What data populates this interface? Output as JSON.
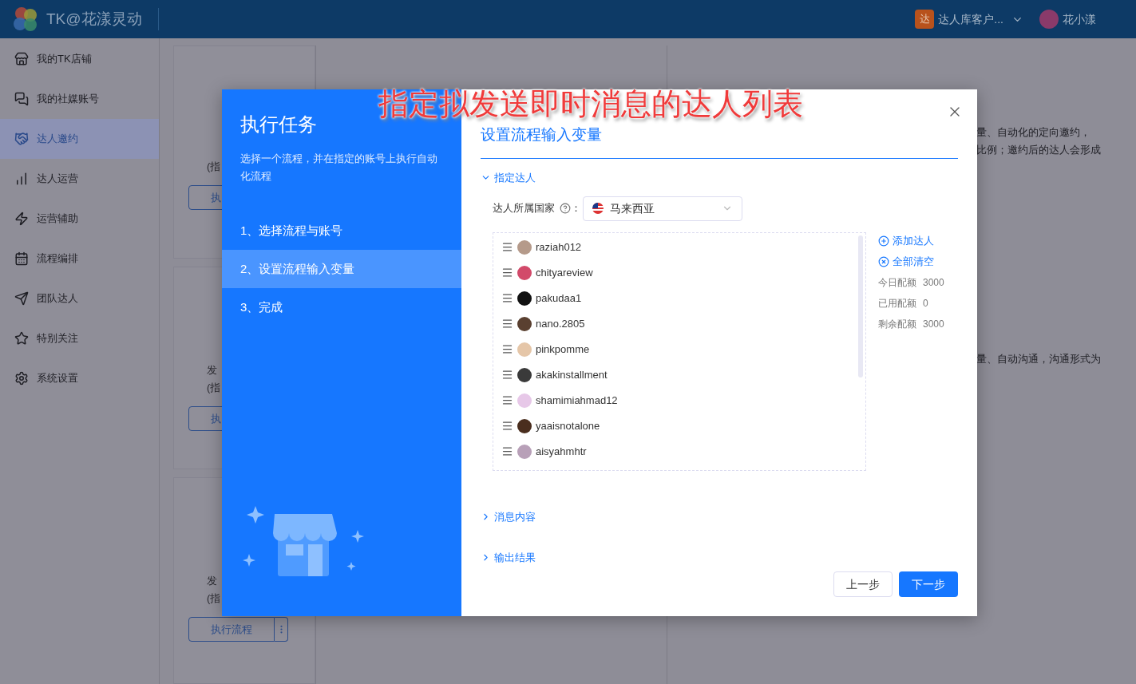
{
  "header": {
    "app_name": "TK@花漾灵动",
    "team_badge": "达",
    "team_name": "达人库客户...",
    "user_name": "花小漾"
  },
  "sidebar": {
    "items": [
      {
        "label": "我的TK店铺",
        "selected": false
      },
      {
        "label": "我的社媒账号",
        "selected": false
      },
      {
        "label": "达人邀约",
        "selected": true
      },
      {
        "label": "达人运营",
        "selected": false
      },
      {
        "label": "运营辅助",
        "selected": false
      },
      {
        "label": "流程编排",
        "selected": false
      },
      {
        "label": "团队达人",
        "selected": false
      },
      {
        "label": "特别关注",
        "selected": false
      },
      {
        "label": "系统设置",
        "selected": false
      }
    ]
  },
  "background": {
    "left_cards": [
      {
        "lines": [
          "(指"
        ],
        "button": "执"
      },
      {
        "lines": [
          "发",
          "(指"
        ],
        "button": "执"
      },
      {
        "lines": [
          "发",
          "(指"
        ],
        "button": "执行流程",
        "menu": true
      }
    ],
    "right_texts": [
      [
        "量、自动化的定向邀约，",
        "比例；邀约后的达人会形成"
      ],
      [
        "量、自动沟通，沟通形式为"
      ]
    ]
  },
  "annotation": "指定拟发送即时消息的达人列表",
  "dialog": {
    "title": "执行任务",
    "description": "选择一个流程，并在指定的账号上执行自动化流程",
    "steps": [
      {
        "label": "1、选择流程与账号",
        "selected": false
      },
      {
        "label": "2、设置流程输入变量",
        "selected": true
      },
      {
        "label": "3、完成",
        "selected": false
      }
    ],
    "heading": "设置流程输入变量",
    "sections": [
      {
        "label": "指定达人",
        "expanded": true
      },
      {
        "label": "消息内容",
        "expanded": false
      },
      {
        "label": "输出结果",
        "expanded": false
      }
    ],
    "country_label": "达人所属国家",
    "country_colon": "：",
    "country_value": "马来西亚",
    "creators": [
      "raziah012",
      "chityareview",
      "pakudaa1",
      "nano.2805",
      "pinkpomme",
      "akakinstallment",
      "shamimiahmad12",
      "yaaisnotalone",
      "aisyahmhtr"
    ],
    "actions": [
      "添加达人",
      "全部清空"
    ],
    "quota": [
      {
        "label": "今日配额",
        "value": "3000"
      },
      {
        "label": "已用配额",
        "value": "0"
      },
      {
        "label": "剩余配额",
        "value": "3000"
      }
    ],
    "buttons": [
      {
        "label": "上一步",
        "kind": "secondary"
      },
      {
        "label": "下一步",
        "kind": "primary"
      }
    ]
  }
}
